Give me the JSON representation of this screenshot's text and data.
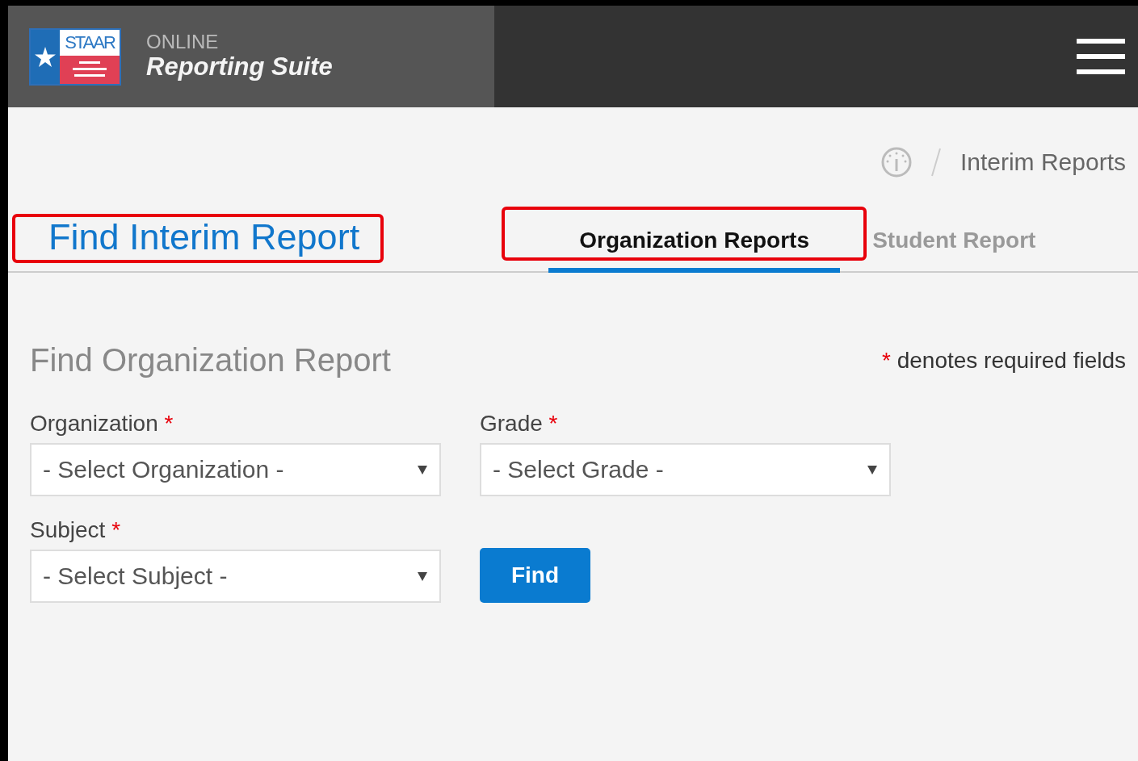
{
  "header": {
    "logo_text": "STAAR",
    "subtitle": "ONLINE",
    "title": "Reporting Suite"
  },
  "breadcrumb": {
    "current": "Interim Reports"
  },
  "page_title": {
    "text": "Find Interim Report",
    "highlighted": true
  },
  "tabs": [
    {
      "label": "Organization Reports",
      "selected": true,
      "highlighted": true
    },
    {
      "label": "Student Report",
      "selected": false,
      "highlighted": false
    }
  ],
  "form": {
    "title": "Find Organization Report",
    "required_note": {
      "mark": "*",
      "text": "denotes required fields"
    },
    "fields": [
      {
        "label": "Organization",
        "required_mark": "*",
        "placeholder": "- Select Organization -"
      },
      {
        "label": "Grade",
        "required_mark": "*",
        "placeholder": "- Select Grade -"
      },
      {
        "label": "Subject",
        "required_mark": "*",
        "placeholder": "- Select Subject -"
      }
    ],
    "find_button": "Find"
  }
}
